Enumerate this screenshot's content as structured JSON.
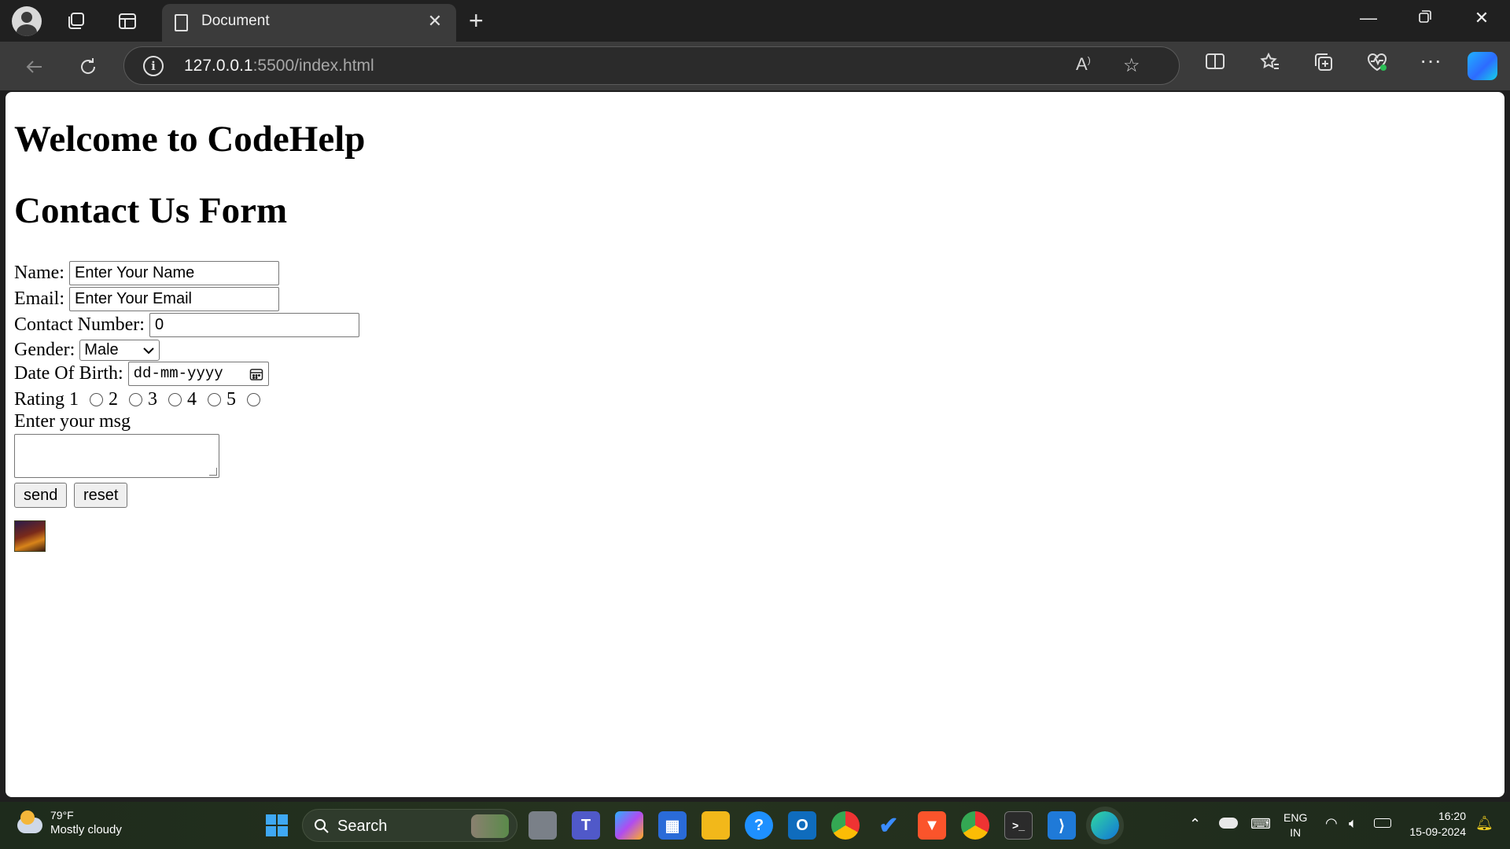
{
  "browser": {
    "tab_title": "Document",
    "url_host": "127.0.0.1",
    "url_path": ":5500/index.html",
    "new_tab_label": "+",
    "close_tab_label": "✕"
  },
  "page": {
    "heading1": "Welcome to CodeHelp",
    "heading2": "Contact Us Form",
    "name_label": "Name:",
    "name_value": "Enter Your Name",
    "email_label": "Email:",
    "email_value": "Enter Your Email",
    "contact_label": "Contact Number:",
    "contact_value": "0",
    "gender_label": "Gender:",
    "gender_selected": "Male",
    "dob_label": "Date Of Birth:",
    "dob_placeholder": "dd-mm-yyyy",
    "rating_label": "Rating",
    "rating_options": [
      "1",
      "2",
      "3",
      "4",
      "5"
    ],
    "msg_label": "Enter your msg",
    "send_label": "send",
    "reset_label": "reset"
  },
  "taskbar": {
    "temperature": "79°F",
    "weather": "Mostly cloudy",
    "search_label": "Search",
    "language_top": "ENG",
    "language_bottom": "IN",
    "time": "16:20",
    "date": "15-09-2024"
  },
  "colors": {
    "titlebar": "#202020",
    "toolbar": "#3b3b3b",
    "page_background": "#ffffff",
    "taskbar": "#1e2b1c"
  }
}
